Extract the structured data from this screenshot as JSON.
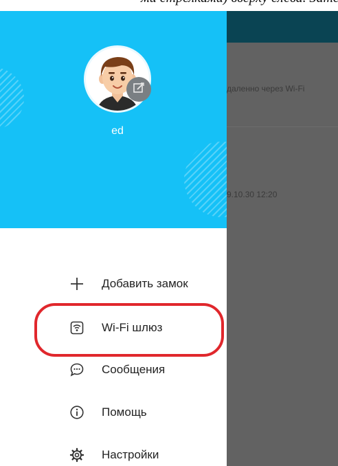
{
  "top_caption": "ми стрелками) вверху слева. Затем нажмите на",
  "background_app": {
    "row1_text": "даленно через Wi-Fi",
    "row2_text": "9.10.30 12:20"
  },
  "profile": {
    "username": "ed"
  },
  "menu": {
    "items": [
      {
        "label": "Добавить замок",
        "icon": "plus-icon"
      },
      {
        "label": "Wi-Fi шлюз",
        "icon": "wifi-gateway-icon"
      },
      {
        "label": "Сообщения",
        "icon": "chat-bubble-icon"
      },
      {
        "label": "Помощь",
        "icon": "info-icon"
      },
      {
        "label": "Настройки",
        "icon": "gear-icon"
      }
    ]
  },
  "colors": {
    "header_bg": "#15c1f7",
    "highlight": "#e0272c",
    "overlay_bg": "#626262",
    "appbar_bg": "#0a4453"
  }
}
